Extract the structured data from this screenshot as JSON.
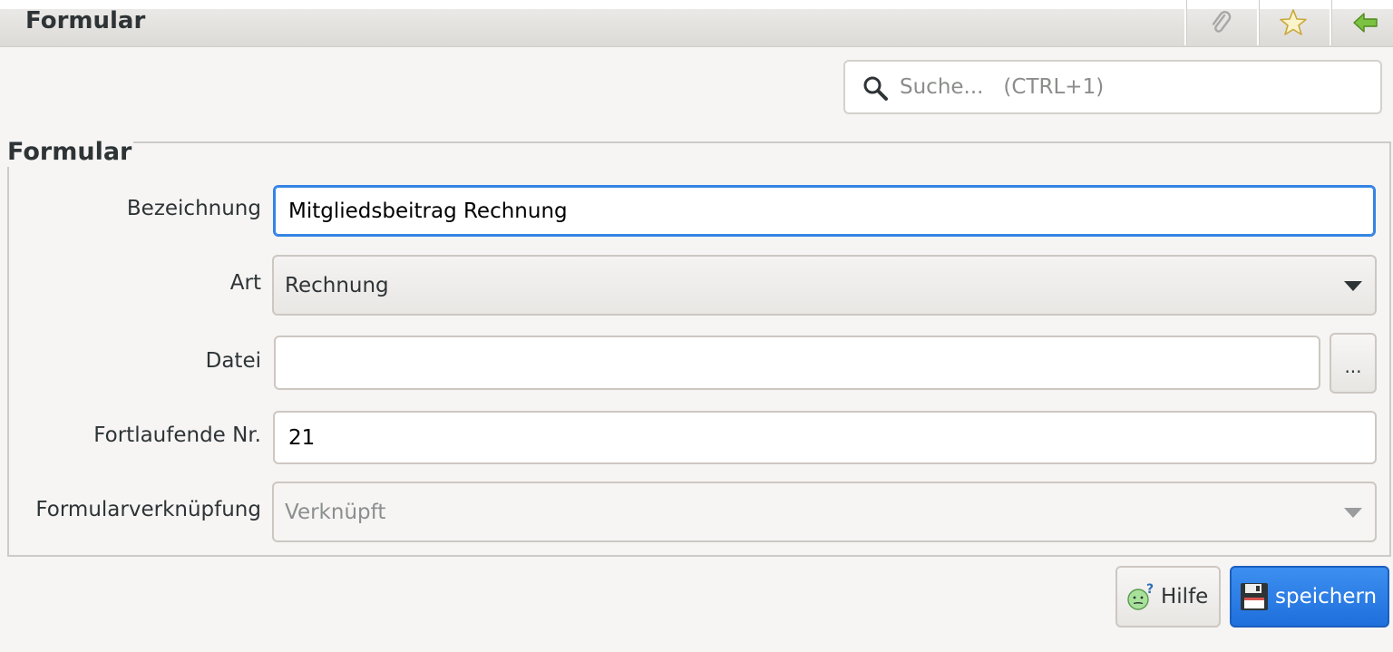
{
  "header": {
    "title": "Formular",
    "buttons": [
      {
        "icon": "paperclip-icon"
      },
      {
        "icon": "star-icon"
      },
      {
        "icon": "back-arrow-icon"
      }
    ]
  },
  "search": {
    "placeholder": "Suche...   (CTRL+1)"
  },
  "form": {
    "group_title": "Formular",
    "bezeichnung": {
      "label": "Bezeichnung",
      "value": "Mitgliedsbeitrag Rechnung"
    },
    "art": {
      "label": "Art",
      "value": "Rechnung"
    },
    "datei": {
      "label": "Datei",
      "value": "",
      "browse_label": "..."
    },
    "fortlaufende_nr": {
      "label": "Fortlaufende Nr.",
      "value": "21"
    },
    "formularverknuepfung": {
      "label": "Formularverknüpfung",
      "value": "Verknüpft"
    }
  },
  "actions": {
    "help_label": "Hilfe",
    "save_label": "speichern"
  },
  "colors": {
    "accent": "#3584e4",
    "primary_button": "#2a7de9"
  }
}
